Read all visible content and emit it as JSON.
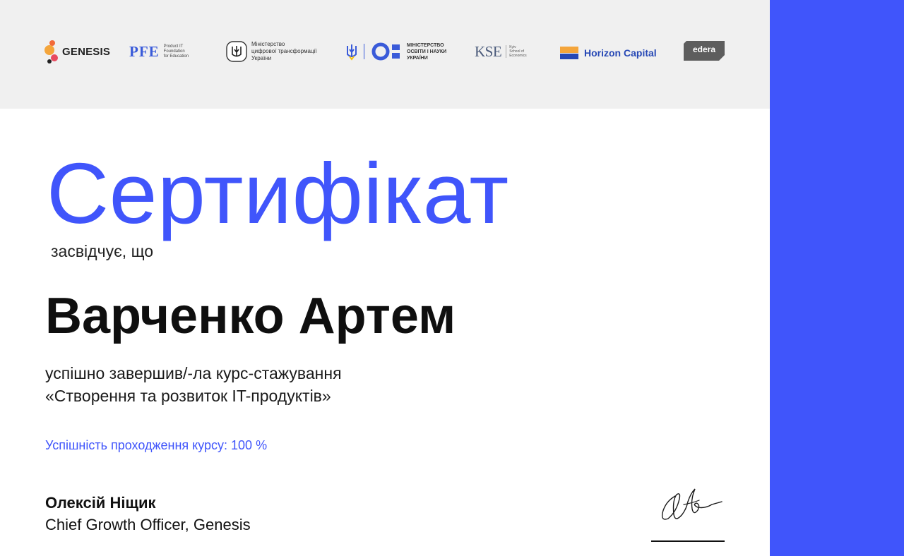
{
  "certificate": {
    "title": "Сертифікат",
    "certifies_text": "засвідчує, що",
    "recipient_name": "Варченко Артем",
    "completion_line1": "успішно завершив/-ла курс-стажування",
    "completion_line2": "«Створення та розвиток IT-продуктів»",
    "success_rate_text": "Успішність проходження курсу: 100 %"
  },
  "signer": {
    "name": "Олексій Ніщик",
    "role": "Chief Growth Officer, Genesis"
  },
  "logos": {
    "genesis": "GENESIS",
    "pfe": "PFE",
    "pfe_tagline": "Product IT\nFoundation\nfor Education",
    "mincyfra_text": "Міністерство\nцифрової трансформації\nУкраїни",
    "mon_text": "МІНІСТЕРСТВО\nОСВІТИ І НАУКИ\nУКРАЇНИ",
    "kse": "KSE",
    "kse_tagline": "Kyiv\nSchool of\nEconomics",
    "horizon": "Horizon Capital",
    "edera": "edera"
  },
  "colors": {
    "accent": "#4055fb",
    "logo_bar_bg": "#f0f0f0",
    "text_dark": "#0f0f0f"
  }
}
